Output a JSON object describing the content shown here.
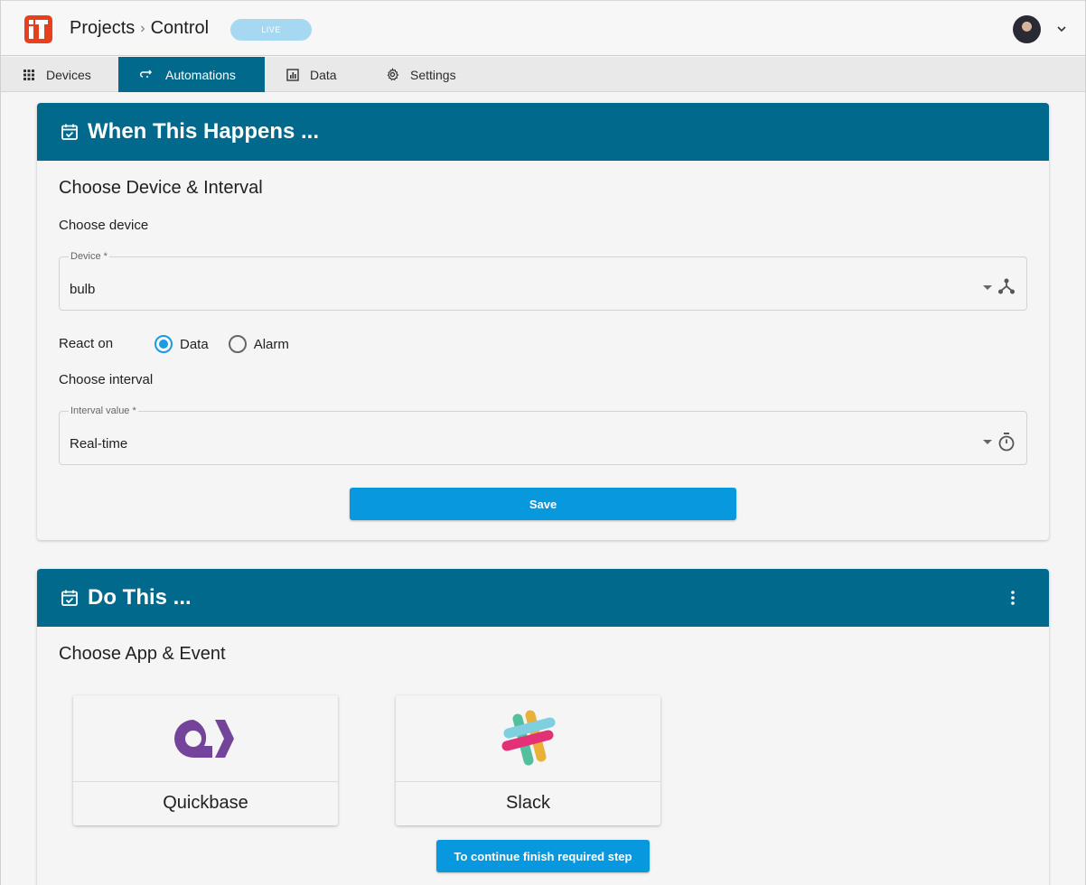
{
  "header": {
    "breadcrumb": [
      "Projects",
      "Control"
    ],
    "separator": "›",
    "status_badge": "LIVE"
  },
  "tabs": [
    {
      "label": "Devices",
      "icon": "grid-icon"
    },
    {
      "label": "Automations",
      "icon": "automation-icon",
      "active": true
    },
    {
      "label": "Data",
      "icon": "chart-icon"
    },
    {
      "label": "Settings",
      "icon": "gear-icon"
    }
  ],
  "trigger_card": {
    "title": "When This Happens ...",
    "section_title": "Choose Device & Interval",
    "choose_device_label": "Choose device",
    "device_field": {
      "legend": "Device *",
      "value": "bulb"
    },
    "react_on": {
      "label": "React on",
      "options": [
        "Data",
        "Alarm"
      ],
      "selected": "Data"
    },
    "choose_interval_label": "Choose interval",
    "interval_field": {
      "legend": "Interval value *",
      "value": "Real-time"
    },
    "save_label": "Save"
  },
  "action_card": {
    "title": "Do This ...",
    "section_title": "Choose App & Event",
    "apps": [
      {
        "name": "Quickbase",
        "icon": "quickbase-logo"
      },
      {
        "name": "Slack",
        "icon": "slack-logo"
      }
    ],
    "continue_label": "To continue finish required step"
  },
  "colors": {
    "primary": "#00698c",
    "accent": "#0898dd",
    "logo": "#e8401c",
    "badge": "#a7d8f1"
  }
}
